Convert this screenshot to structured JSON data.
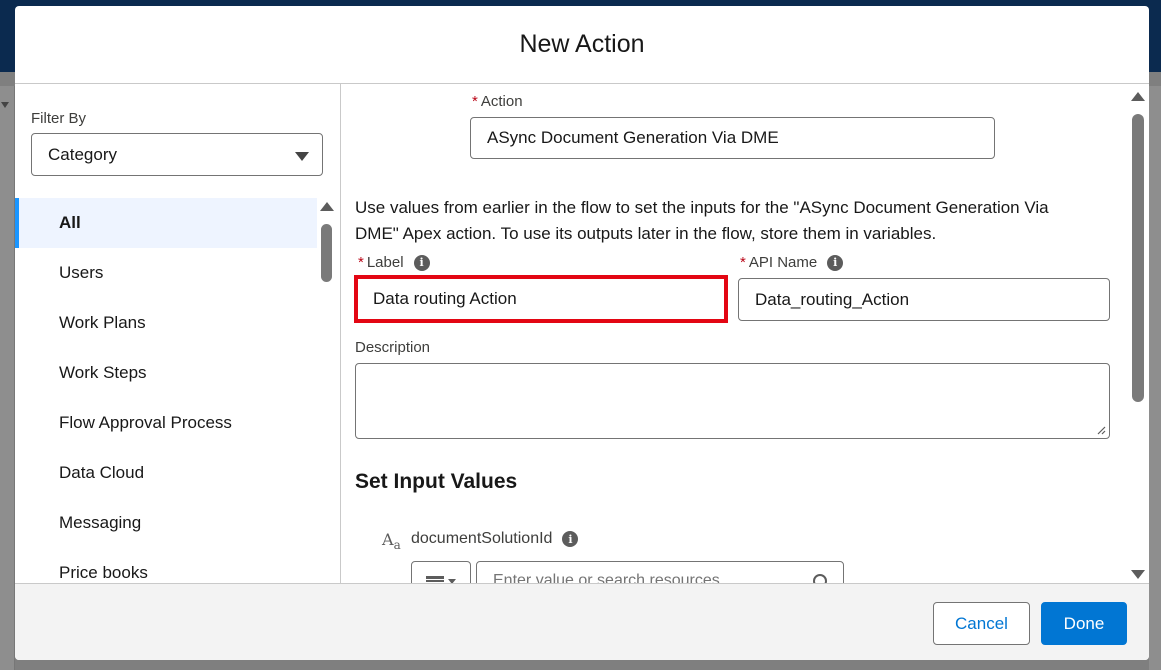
{
  "modal": {
    "title": "New Action"
  },
  "filter": {
    "label": "Filter By",
    "selected": "Category"
  },
  "categories": [
    {
      "label": "All",
      "active": true
    },
    {
      "label": "Users"
    },
    {
      "label": "Work Plans"
    },
    {
      "label": "Work Steps"
    },
    {
      "label": "Flow Approval Process"
    },
    {
      "label": "Data Cloud"
    },
    {
      "label": "Messaging"
    },
    {
      "label": "Price books"
    }
  ],
  "form": {
    "required_marker": "*",
    "info_glyph": "i",
    "action_label": "Action",
    "action_value": "ASync Document Generation Via DME",
    "help_text": "Use values from earlier in the flow to set the inputs for the \"ASync Document Generation Via DME\" Apex action. To use its outputs later in the flow, store them in variables.",
    "label_label": "Label",
    "label_value": "Data routing Action",
    "api_name_label": "API Name",
    "api_name_value": "Data_routing_Action",
    "description_label": "Description",
    "description_value": "",
    "section_title": "Set Input Values",
    "param_type_glyph": "A",
    "param_type_sub": "a",
    "param_name": "documentSolutionId",
    "param_placeholder": "Enter value or search resources..."
  },
  "footer": {
    "cancel_label": "Cancel",
    "done_label": "Done"
  },
  "colors": {
    "brand": "#0176d3",
    "highlight": "#e30613",
    "required": "#ba0517",
    "active_bar": "#1b96ff"
  }
}
